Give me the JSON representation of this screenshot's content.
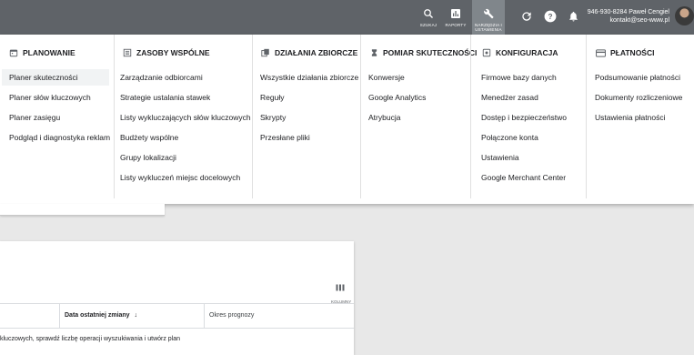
{
  "topbar": {
    "search_label": "SZUKAJ",
    "reports_label": "RAPORTY",
    "tools_label": "NARZĘDZIA I USTAWIENIA",
    "account_phone_name": "946-930-8284 Paweł Cengiel",
    "account_email": "kontakt@seo-www.pl"
  },
  "menu": {
    "columns": [
      {
        "title": "PLANOWANIE",
        "icon": "calendar-icon",
        "items": [
          "Planer skuteczności",
          "Planer słów kluczowych",
          "Planer zasięgu",
          "Podgląd i diagnostyka reklam"
        ]
      },
      {
        "title": "ZASOBY WSPÓLNE",
        "icon": "library-icon",
        "items": [
          "Zarządzanie odbiorcami",
          "Strategie ustalania stawek",
          "Listy wykluczających słów kluczowych",
          "Budżety wspólne",
          "Grupy lokalizacji",
          "Listy wykluczeń miejsc docelowych"
        ]
      },
      {
        "title": "DZIAŁANIA ZBIORCZE",
        "icon": "copy-icon",
        "items": [
          "Wszystkie działania zbiorcze",
          "Reguły",
          "Skrypty",
          "Przesłane pliki"
        ]
      },
      {
        "title": "POMIAR SKUTECZNOŚCI",
        "icon": "hourglass-icon",
        "items": [
          "Konwersje",
          "Google Analytics",
          "Atrybucja"
        ]
      },
      {
        "title": "KONFIGURACJA",
        "icon": "settings-box-icon",
        "items": [
          "Firmowe bazy danych",
          "Menedżer zasad",
          "Dostęp i bezpieczeństwo",
          "Połączone konta",
          "Ustawienia",
          "Google Merchant Center"
        ]
      },
      {
        "title": "PŁATNOŚCI",
        "icon": "credit-card-icon",
        "items": [
          "Podsumowanie płatności",
          "Dokumenty rozliczeniowe",
          "Ustawienia płatności"
        ]
      }
    ]
  },
  "table": {
    "columns_label": "KOLUMNY",
    "header_date": "Data ostatniej zmiany",
    "header_forecast": "Okres prognozy",
    "hint": "kluczowych, sprawdź liczbę operacji wyszukiwania i utwórz plan"
  }
}
